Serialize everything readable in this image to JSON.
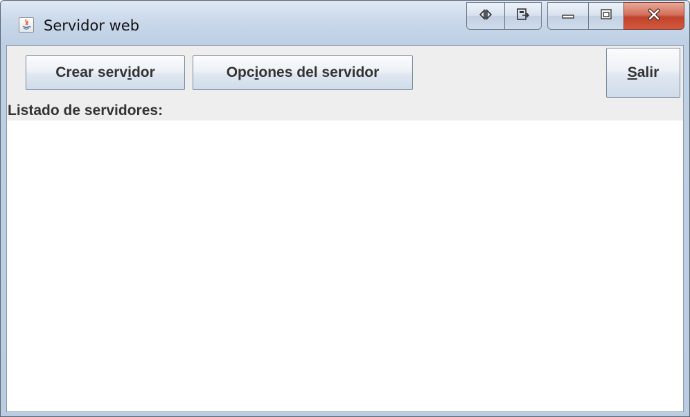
{
  "window": {
    "title": "Servidor web",
    "icon": "java-icon",
    "controls": [
      "ruler-icon",
      "export-icon",
      "minimize-icon",
      "maximize-icon",
      "close-icon"
    ]
  },
  "toolbar": {
    "create_server": {
      "before": "Crear serv",
      "mnemonic": "i",
      "after": "dor"
    },
    "server_options": {
      "before": "Opc",
      "mnemonic": "i",
      "after": "ones del servidor"
    },
    "exit": {
      "before": "",
      "mnemonic": "S",
      "after": "alir"
    }
  },
  "listing": {
    "label": "Listado de servidores:",
    "items": []
  }
}
